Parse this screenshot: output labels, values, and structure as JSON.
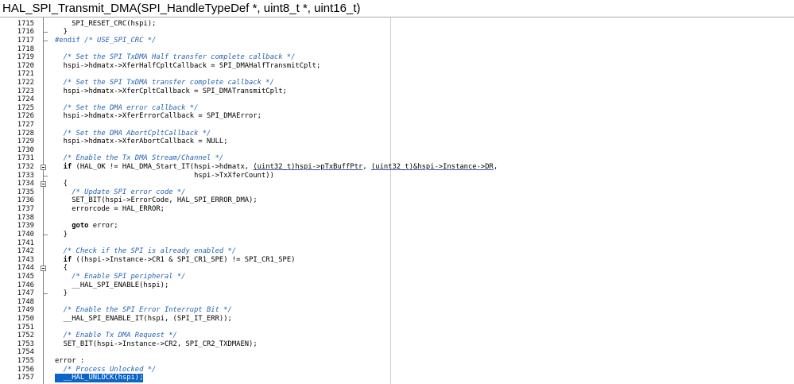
{
  "title": "HAL_SPI_Transmit_DMA(SPI_HandleTypeDef *, uint8_t *, uint16_t)",
  "colors": {
    "selection": "#0c64c8",
    "selection_text": "#ffffff",
    "underline": "#2a58b0"
  },
  "editor": {
    "lines": [
      {
        "n": "1715",
        "segs": [
          {
            "text": "    SPI_RESET_CRC(hspi);"
          }
        ]
      },
      {
        "n": "1716",
        "segs": [
          {
            "text": "  }"
          }
        ],
        "marker": "fold-end-icon"
      },
      {
        "n": "1717",
        "segs": [
          {
            "text": "#endif ",
            "color": "#2563b5"
          },
          {
            "text": "/* USE_SPI_CRC */",
            "color": "#2563b5",
            "italic": true
          }
        ],
        "marker": "fold-end-icon"
      },
      {
        "n": "1718",
        "segs": []
      },
      {
        "n": "1719",
        "segs": [
          {
            "text": "  /* Set the SPI TxDMA Half transfer complete callback */",
            "color": "#2563b5",
            "italic": true
          }
        ]
      },
      {
        "n": "1720",
        "segs": [
          {
            "text": "  hspi->hdmatx->XferHalfCpltCallback = SPI_DMAHalfTransmitCplt;"
          }
        ]
      },
      {
        "n": "1721",
        "segs": []
      },
      {
        "n": "1722",
        "segs": [
          {
            "text": "  /* Set the SPI TxDMA transfer complete callback */",
            "color": "#2563b5",
            "italic": true
          }
        ]
      },
      {
        "n": "1723",
        "segs": [
          {
            "text": "  hspi->hdmatx->XferCpltCallback = SPI_DMATransmitCplt;"
          }
        ]
      },
      {
        "n": "1724",
        "segs": []
      },
      {
        "n": "1725",
        "segs": [
          {
            "text": "  /* Set the DMA error callback */",
            "color": "#2563b5",
            "italic": true
          }
        ]
      },
      {
        "n": "1726",
        "segs": [
          {
            "text": "  hspi->hdmatx->XferErrorCallback = SPI_DMAError;"
          }
        ]
      },
      {
        "n": "1727",
        "segs": []
      },
      {
        "n": "1728",
        "segs": [
          {
            "text": "  /* Set the DMA AbortCpltCallback */",
            "color": "#2563b5",
            "italic": true
          }
        ]
      },
      {
        "n": "1729",
        "segs": [
          {
            "text": "  hspi->hdmatx->XferAbortCallback = NULL;"
          }
        ]
      },
      {
        "n": "1730",
        "segs": []
      },
      {
        "n": "1731",
        "segs": [
          {
            "text": "  /* Enable the Tx DMA Stream/Channel */",
            "color": "#2563b5",
            "italic": true
          }
        ]
      },
      {
        "n": "1732",
        "segs": [
          {
            "text": "  if",
            "bold": true
          },
          {
            "text": " (HAL_OK != HAL_DMA_Start_IT(hspi->hdmatx, "
          },
          {
            "text": "(uint32_t)hspi->pTxBuffPtr",
            "underline": true
          },
          {
            "text": ", "
          },
          {
            "text": "(uint32_t)&hspi->Instance->DR",
            "underline": true
          },
          {
            "text": ","
          }
        ],
        "marker": "fold-collapse-icon"
      },
      {
        "n": "1733",
        "segs": [
          {
            "text": "                                 hspi->TxXferCount))"
          }
        ],
        "marker": "fold-end-icon"
      },
      {
        "n": "1734",
        "segs": [
          {
            "text": "  {"
          }
        ],
        "marker": "fold-collapse-icon"
      },
      {
        "n": "1735",
        "segs": [
          {
            "text": "    /* Update SPI error code */",
            "color": "#2563b5",
            "italic": true
          }
        ]
      },
      {
        "n": "1736",
        "segs": [
          {
            "text": "    SET_BIT(hspi->ErrorCode, HAL_SPI_ERROR_DMA);"
          }
        ]
      },
      {
        "n": "1737",
        "segs": [
          {
            "text": "    errorcode = HAL_ERROR;"
          }
        ]
      },
      {
        "n": "1738",
        "segs": []
      },
      {
        "n": "1739",
        "segs": [
          {
            "text": "    goto",
            "bold": true
          },
          {
            "text": " error;"
          }
        ]
      },
      {
        "n": "1740",
        "segs": [
          {
            "text": "  }"
          }
        ],
        "marker": "fold-end-icon"
      },
      {
        "n": "1741",
        "segs": []
      },
      {
        "n": "1742",
        "segs": [
          {
            "text": "  /* Check if the SPI is already enabled */",
            "color": "#2563b5",
            "italic": true
          }
        ]
      },
      {
        "n": "1743",
        "segs": [
          {
            "text": "  if",
            "bold": true
          },
          {
            "text": " ((hspi->Instance->CR1 & SPI_CR1_SPE) != SPI_CR1_SPE)"
          }
        ]
      },
      {
        "n": "1744",
        "segs": [
          {
            "text": "  {"
          }
        ],
        "marker": "fold-collapse-icon"
      },
      {
        "n": "1745",
        "segs": [
          {
            "text": "    /* Enable SPI peripheral */",
            "color": "#2563b5",
            "italic": true
          }
        ]
      },
      {
        "n": "1746",
        "segs": [
          {
            "text": "    __HAL_SPI_ENABLE(hspi);"
          }
        ]
      },
      {
        "n": "1747",
        "segs": [
          {
            "text": "  }"
          }
        ],
        "marker": "fold-end-icon"
      },
      {
        "n": "1748",
        "segs": []
      },
      {
        "n": "1749",
        "segs": [
          {
            "text": "  /* Enable the SPI Error Interrupt Bit */",
            "color": "#2563b5",
            "italic": true
          }
        ]
      },
      {
        "n": "1750",
        "segs": [
          {
            "text": "  __HAL_SPI_ENABLE_IT(hspi, (SPI_IT_ERR));"
          }
        ]
      },
      {
        "n": "1751",
        "segs": []
      },
      {
        "n": "1752",
        "segs": [
          {
            "text": "  /* Enable Tx DMA Request */",
            "color": "#2563b5",
            "italic": true
          }
        ]
      },
      {
        "n": "1753",
        "segs": [
          {
            "text": "  SET_BIT(hspi->Instance->CR2, SPI_CR2_TXDMAEN);"
          }
        ]
      },
      {
        "n": "1754",
        "segs": []
      },
      {
        "n": "1755",
        "segs": [
          {
            "text": "error :"
          }
        ]
      },
      {
        "n": "1756",
        "segs": [
          {
            "text": "  /* Process Unlocked */",
            "color": "#2563b5",
            "italic": true
          }
        ]
      },
      {
        "n": "1757",
        "segs": [
          {
            "text": "  __HAL_UNLOCK(hspi);"
          }
        ],
        "selected": true
      }
    ]
  }
}
